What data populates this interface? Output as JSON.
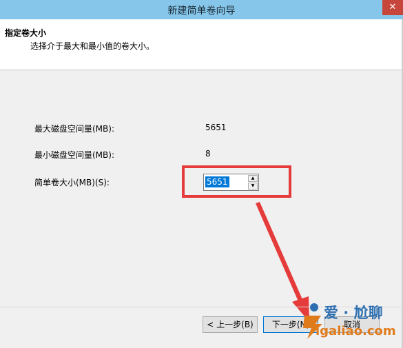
{
  "window": {
    "title": "新建简单卷向导",
    "close_glyph": "✕"
  },
  "header": {
    "title": "指定卷大小",
    "subtitle": "选择介于最大和最小值的卷大小。"
  },
  "fields": {
    "max_label": "最大磁盘空间量(MB):",
    "max_value": "5651",
    "min_label": "最小磁盘空间量(MB):",
    "min_value": "8",
    "size_label": "简单卷大小(MB)(S):",
    "size_value": "5651"
  },
  "buttons": {
    "back": "< 上一步(B)",
    "next": "下一步(N)",
    "cancel": "取消"
  },
  "watermark": {
    "brand": "爱 · 尬聊",
    "url": "igaliao.com"
  },
  "colors": {
    "titlebar": "#85c6ea",
    "highlight": "#e63b3b",
    "selection": "#0078d7"
  }
}
